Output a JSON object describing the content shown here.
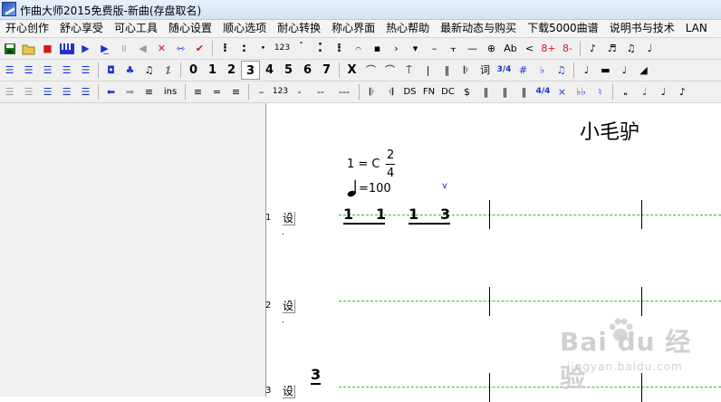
{
  "window": {
    "title": "作曲大师2015免费版-新曲(存盘取名)"
  },
  "menu": [
    "开心创作",
    "舒心享受",
    "可心工具",
    "随心设置",
    "顺心选项",
    "耐心转换",
    "称心界面",
    "热心帮助",
    "最新动态与购买",
    "下载5000曲谱",
    "说明书与技术",
    "LAN"
  ],
  "toolbar1": {
    "labels": [
      "123",
      "Ab",
      "<",
      "8+",
      "8-"
    ]
  },
  "toolbar2": {
    "digits": [
      "0",
      "1",
      "2",
      "3",
      "4",
      "5",
      "6",
      "7"
    ],
    "selected_digit": "3",
    "labels": [
      "X",
      "词",
      "3/4",
      "#",
      "♭"
    ]
  },
  "toolbar3": {
    "labels": [
      "ins",
      "123",
      "-",
      "--",
      "---",
      "DS",
      "FN",
      "DC",
      "$",
      "4/4",
      "×",
      "♭♭",
      "♮"
    ]
  },
  "score": {
    "title": "小毛驴",
    "key": "1 = C",
    "time_top": "2",
    "time_bottom": "4",
    "tempo": "=100",
    "bow_mark": "v",
    "line_set_label": "设",
    "line_numbers": [
      "1",
      "2",
      "3"
    ],
    "measure1_notes": [
      "1",
      "1",
      "1",
      "3"
    ],
    "line3_note": "3"
  },
  "watermark": {
    "brand": "Bai du 经验",
    "url": "jingyan.baidu.com"
  }
}
